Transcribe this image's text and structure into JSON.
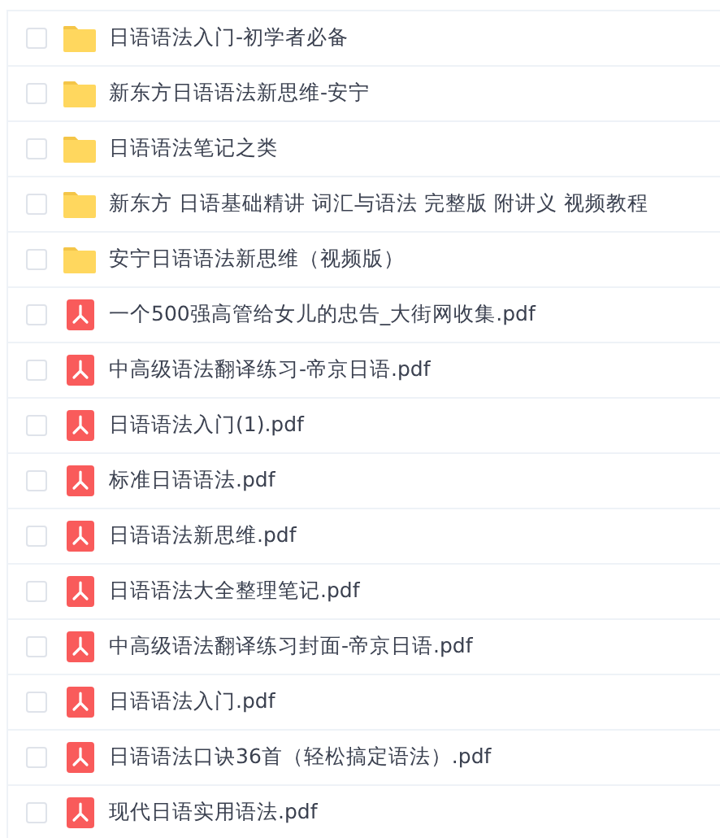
{
  "files": [
    {
      "kind": "folder",
      "name": "日语语法入门-初学者必备",
      "checked": false
    },
    {
      "kind": "folder",
      "name": "新东方日语语法新思维-安宁",
      "checked": false
    },
    {
      "kind": "folder",
      "name": "日语语法笔记之类",
      "checked": false
    },
    {
      "kind": "folder",
      "name": "新东方 日语基础精讲 词汇与语法 完整版 附讲义 视频教程",
      "checked": false
    },
    {
      "kind": "folder",
      "name": "安宁日语语法新思维（视频版）",
      "checked": false
    },
    {
      "kind": "pdf",
      "name": "一个500强高管给女儿的忠告_大街网收集.pdf",
      "checked": false
    },
    {
      "kind": "pdf",
      "name": "中高级语法翻译练习-帝京日语.pdf",
      "checked": false
    },
    {
      "kind": "pdf",
      "name": "日语语法入门(1).pdf",
      "checked": false
    },
    {
      "kind": "pdf",
      "name": "标准日语语法.pdf",
      "checked": false
    },
    {
      "kind": "pdf",
      "name": "日语语法新思维.pdf",
      "checked": false
    },
    {
      "kind": "pdf",
      "name": "日语语法大全整理笔记.pdf",
      "checked": false
    },
    {
      "kind": "pdf",
      "name": "中高级语法翻译练习封面-帝京日语.pdf",
      "checked": false
    },
    {
      "kind": "pdf",
      "name": "日语语法入门.pdf",
      "checked": false
    },
    {
      "kind": "pdf",
      "name": "日语语法口诀36首（轻松搞定语法）.pdf",
      "checked": false
    },
    {
      "kind": "pdf",
      "name": "现代日语实用语法.pdf",
      "checked": false
    }
  ]
}
